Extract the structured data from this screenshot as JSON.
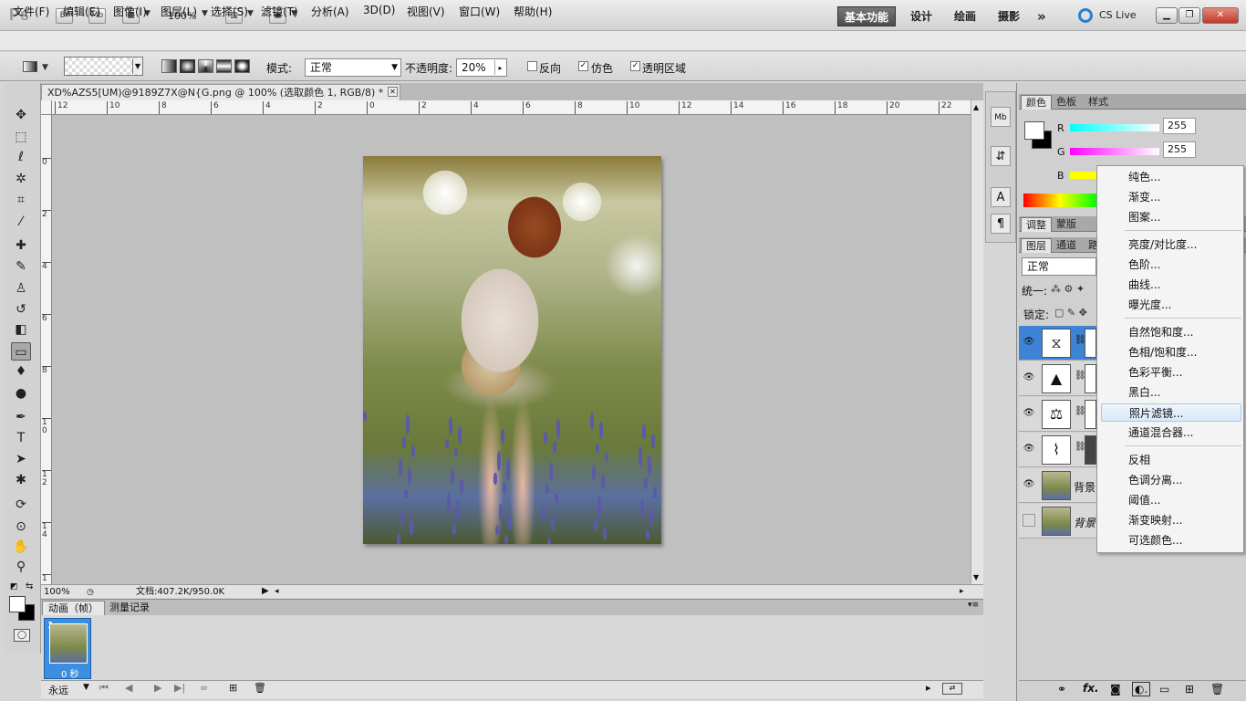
{
  "titlebar": {
    "logo": "Ps",
    "bridge": "Br",
    "minibridge": "Mb",
    "zoom": "100%",
    "workspaces": [
      "基本功能",
      "设计",
      "绘画",
      "摄影"
    ],
    "more": "»",
    "cslive": "CS Live"
  },
  "menubar": [
    "文件(F)",
    "编辑(E)",
    "图像(I)",
    "图层(L)",
    "选择(S)",
    "滤镜(T)",
    "分析(A)",
    "3D(D)",
    "视图(V)",
    "窗口(W)",
    "帮助(H)"
  ],
  "options": {
    "mode_label": "模式:",
    "mode_value": "正常",
    "opacity_label": "不透明度:",
    "opacity_value": "20%",
    "reverse": "反向",
    "dither": "仿色",
    "transparency": "透明区域",
    "reverse_checked": false,
    "dither_checked": true,
    "transparency_checked": true
  },
  "document": {
    "tab_title": "XD%AZS5[UM)@9189Z7X@N{G.png @ 100% (选取颜色 1, RGB/8) *",
    "zoom": "100%",
    "doc_info": "文档:407.2K/950.0K",
    "ruler_top": [
      "12",
      "10",
      "8",
      "6",
      "4",
      "2",
      "0",
      "2",
      "4",
      "6",
      "8",
      "10",
      "12",
      "14",
      "16",
      "18",
      "20",
      "22"
    ],
    "ruler_left": [
      "0",
      "2",
      "4",
      "6",
      "8",
      "1 0",
      "1 2",
      "1 4",
      "1"
    ]
  },
  "animation": {
    "tabs": [
      "动画（帧）",
      "测量记录"
    ],
    "frame_number": "1",
    "frame_delay": "0 秒",
    "loop": "永远"
  },
  "color_panel": {
    "tabs": [
      "颜色",
      "色板",
      "样式"
    ],
    "r_label": "R",
    "g_label": "G",
    "b_label": "B",
    "r_value": "255",
    "g_value": "255"
  },
  "adjust_panel": {
    "tabs": [
      "调整",
      "蒙版"
    ]
  },
  "layers_panel": {
    "tabs": [
      "图层",
      "通道",
      "路"
    ],
    "blend": "正常",
    "unify_label": "统一:",
    "lock_label": "锁定:",
    "layers": [
      {
        "name": "",
        "icon": "curves-ish"
      },
      {
        "name": "",
        "icon": "levels"
      },
      {
        "name": "",
        "icon": "balance"
      },
      {
        "name": "",
        "icon": "curves"
      },
      {
        "name": "背景",
        "icon": "photo"
      },
      {
        "name": "背景",
        "icon": "photo"
      }
    ]
  },
  "context_menu": {
    "items": [
      "纯色...",
      "渐变...",
      "图案...",
      "亮度/对比度...",
      "色阶...",
      "曲线...",
      "曝光度...",
      "自然饱和度...",
      "色相/饱和度...",
      "色彩平衡...",
      "黑白...",
      "照片滤镜...",
      "通道混合器...",
      "反相",
      "色调分离...",
      "阈值...",
      "渐变映射...",
      "可选颜色..."
    ],
    "highlighted": "照片滤镜..."
  },
  "colors": {
    "accent": "#3d84d6",
    "menu_highlight": "#d9e8f9"
  }
}
